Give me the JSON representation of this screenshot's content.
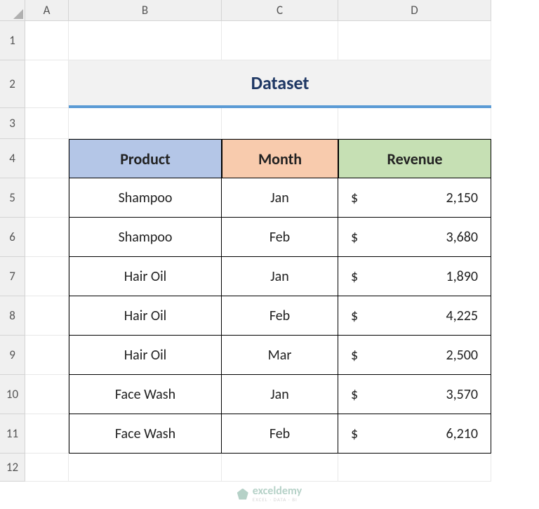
{
  "columns": [
    "A",
    "B",
    "C",
    "D"
  ],
  "rows": [
    "1",
    "2",
    "3",
    "4",
    "5",
    "6",
    "7",
    "8",
    "9",
    "10",
    "11",
    "12"
  ],
  "title": "Dataset",
  "headers": {
    "product": "Product",
    "month": "Month",
    "revenue": "Revenue"
  },
  "currency_symbol": "$",
  "data": [
    {
      "product": "Shampoo",
      "month": "Jan",
      "revenue": "2,150"
    },
    {
      "product": "Shampoo",
      "month": "Feb",
      "revenue": "3,680"
    },
    {
      "product": "Hair Oil",
      "month": "Jan",
      "revenue": "1,890"
    },
    {
      "product": "Hair Oil",
      "month": "Feb",
      "revenue": "4,225"
    },
    {
      "product": "Hair Oil",
      "month": "Mar",
      "revenue": "2,500"
    },
    {
      "product": "Face Wash",
      "month": "Jan",
      "revenue": "3,570"
    },
    {
      "product": "Face Wash",
      "month": "Feb",
      "revenue": "6,210"
    }
  ],
  "watermark": {
    "main": "exceldemy",
    "sub": "EXCEL · DATA · BI"
  }
}
